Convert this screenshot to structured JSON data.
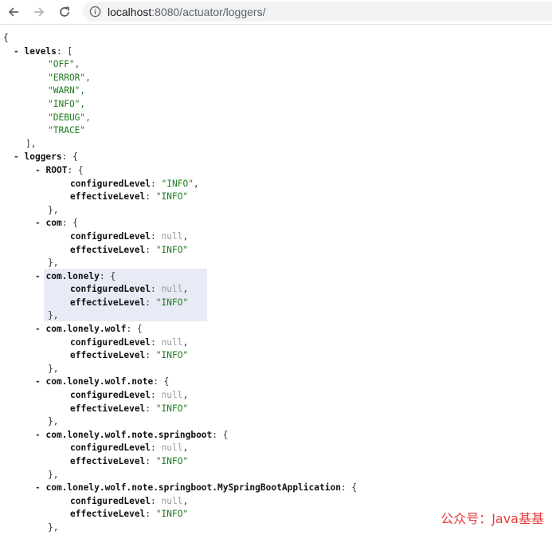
{
  "browser": {
    "url_host": "localhost",
    "url_rest": ":8080/actuator/loggers/"
  },
  "json": {
    "open_brace": "{",
    "levels_key": "levels",
    "levels": [
      "\"OFF\",",
      "\"ERROR\",",
      "\"WARN\",",
      "\"INFO\",",
      "\"DEBUG\",",
      "\"TRACE\""
    ],
    "levels_close": "],",
    "loggers_key": "loggers",
    "configured_key": "configuredLevel",
    "effective_key": "effectiveLevel",
    "null_text": "null",
    "entries": [
      {
        "name": "ROOT",
        "configured": "\"INFO\"",
        "effective": "\"INFO\""
      },
      {
        "name": "com",
        "configured": "null",
        "effective": "\"INFO\""
      },
      {
        "name": "com.lonely",
        "configured": "null",
        "effective": "\"INFO\""
      },
      {
        "name": "com.lonely.wolf",
        "configured": "null",
        "effective": "\"INFO\""
      },
      {
        "name": "com.lonely.wolf.note",
        "configured": "null",
        "effective": "\"INFO\""
      },
      {
        "name": "com.lonely.wolf.note.springboot",
        "configured": "null",
        "effective": "\"INFO\""
      },
      {
        "name": "com.lonely.wolf.note.springboot.MySpringBootApplication",
        "configured": "null",
        "effective": "\"INFO\""
      }
    ]
  },
  "watermark": "公众号：Java基基"
}
